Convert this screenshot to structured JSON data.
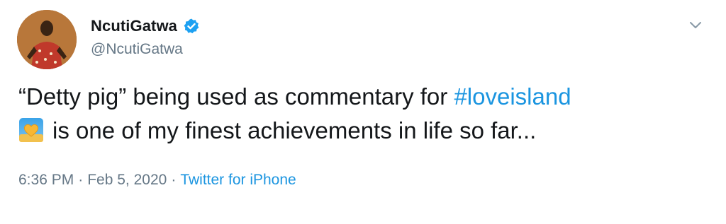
{
  "author": {
    "display_name": "NcutiGatwa",
    "handle": "@NcutiGatwa",
    "verified": true,
    "avatar_icon": "profile-photo"
  },
  "tweet": {
    "text_part1": "“Detty pig” being used as commentary for ",
    "hashtag": "#loveisland",
    "emoji_icon": "yellow-heart-sunset-emoji",
    "text_part2": "is one of my finest achievements in life so far..."
  },
  "meta": {
    "time": "6:36 PM",
    "separator": "·",
    "date": "Feb 5, 2020",
    "source": "Twitter for iPhone"
  },
  "colors": {
    "link": "#1b95e0",
    "secondary_text": "#657786",
    "primary_text": "#14171a",
    "verified_badge": "#1da1f2"
  },
  "menu": {
    "caret_icon": "chevron-down-icon"
  }
}
